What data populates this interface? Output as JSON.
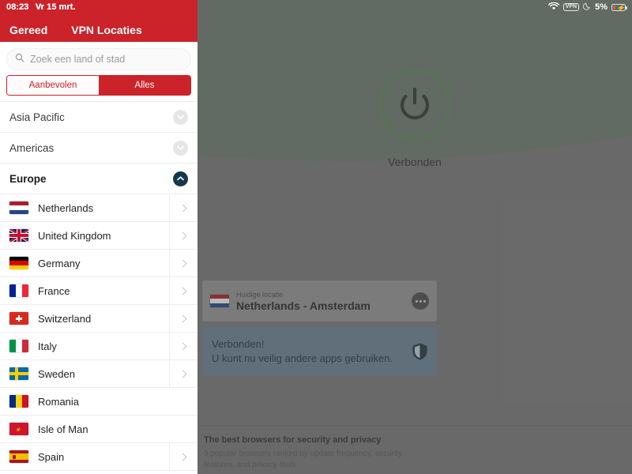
{
  "status_bar": {
    "time": "08:23",
    "date": "Vr 15 mrt.",
    "wifi_icon": "wifi-icon",
    "vpn_badge": "VPN",
    "moon_icon": "crescent-moon-icon",
    "battery_percent": "5%",
    "battery_icon": "battery-charging-icon"
  },
  "sidebar": {
    "header": {
      "done_label": "Gereed",
      "title": "VPN Locaties"
    },
    "search": {
      "placeholder": "Zoek een land of stad",
      "value": "",
      "icon": "search-icon"
    },
    "segments": [
      {
        "label": "Aanbevolen",
        "selected": false
      },
      {
        "label": "Alles",
        "selected": true
      }
    ],
    "regions": [
      {
        "label": "Asia Pacific",
        "expanded": false,
        "disclosure_icon": "chevron-down-icon"
      },
      {
        "label": "Americas",
        "expanded": false,
        "disclosure_icon": "chevron-down-icon"
      },
      {
        "label": "Europe",
        "expanded": true,
        "disclosure_icon": "chevron-up-icon"
      }
    ],
    "countries": [
      {
        "name": "Netherlands",
        "flag": "flag-netherlands",
        "has_chevron": true
      },
      {
        "name": "United Kingdom",
        "flag": "flag-united-kingdom",
        "has_chevron": true
      },
      {
        "name": "Germany",
        "flag": "flag-germany",
        "has_chevron": true
      },
      {
        "name": "France",
        "flag": "flag-france",
        "has_chevron": true
      },
      {
        "name": "Switzerland",
        "flag": "flag-switzerland",
        "has_chevron": true
      },
      {
        "name": "Italy",
        "flag": "flag-italy",
        "has_chevron": true
      },
      {
        "name": "Sweden",
        "flag": "flag-sweden",
        "has_chevron": true
      },
      {
        "name": "Romania",
        "flag": "flag-romania",
        "has_chevron": false
      },
      {
        "name": "Isle of Man",
        "flag": "flag-isle-of-man",
        "has_chevron": false
      },
      {
        "name": "Spain",
        "flag": "flag-spain",
        "has_chevron": true
      }
    ]
  },
  "main": {
    "power": {
      "icon": "power-icon",
      "status_label": "Verbonden"
    },
    "location_card": {
      "flag": "flag-netherlands",
      "subtitle": "Huidige locatie",
      "title": "Netherlands - Amsterdam",
      "more_icon": "more-ellipsis-icon"
    },
    "connected_banner": {
      "title": "Verbonden!",
      "subtitle": "U kunt nu veilig andere apps gebruiken.",
      "icon": "shield-icon"
    },
    "article": {
      "title": "The best browsers for security and privacy",
      "subtitle": "9 popular browsers ranked by update frequency, security features, and privacy tools"
    }
  },
  "colors": {
    "brand_red": "#cc2229",
    "power_ring_green": "#5f8a5c",
    "banner_blue": "#6c8497",
    "disclosure_active": "#16384c",
    "bg_green": "#6e7d71",
    "bg_grey": "#7b7b7b"
  }
}
